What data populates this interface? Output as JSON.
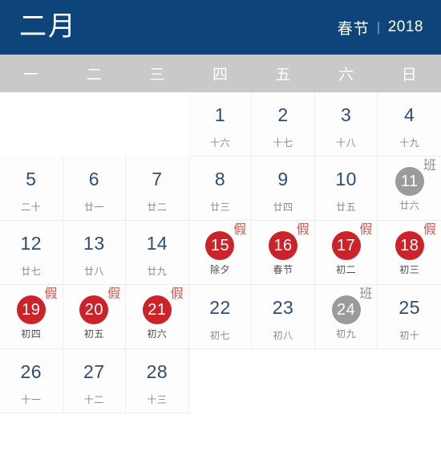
{
  "header": {
    "month_title": "二月",
    "festival_label": "春节",
    "separator": "|",
    "year_label": "2018"
  },
  "weekdays": [
    {
      "label": "一"
    },
    {
      "label": "二"
    },
    {
      "label": "三"
    },
    {
      "label": "四"
    },
    {
      "label": "五"
    },
    {
      "label": "六"
    },
    {
      "label": "日"
    }
  ],
  "colors": {
    "header_bg": "#0d4479",
    "weekday_bg": "#c9c9c9",
    "day_number": "#2d4d74",
    "lunar_text": "#8a8a8a",
    "holiday_red": "#cc2229",
    "workday_gray": "#9b9b9b",
    "cell_border": "#ececec"
  },
  "badge_labels": {
    "holiday": "假",
    "workday": "班"
  },
  "days": [
    {
      "num": "",
      "lunar": "",
      "type": "empty"
    },
    {
      "num": "",
      "lunar": "",
      "type": "empty"
    },
    {
      "num": "",
      "lunar": "",
      "type": "empty"
    },
    {
      "num": "1",
      "lunar": "十六",
      "type": "normal"
    },
    {
      "num": "2",
      "lunar": "十七",
      "type": "normal"
    },
    {
      "num": "3",
      "lunar": "十八",
      "type": "normal"
    },
    {
      "num": "4",
      "lunar": "十九",
      "type": "normal"
    },
    {
      "num": "5",
      "lunar": "二十",
      "type": "normal"
    },
    {
      "num": "6",
      "lunar": "廿一",
      "type": "normal"
    },
    {
      "num": "7",
      "lunar": "廿二",
      "type": "normal"
    },
    {
      "num": "8",
      "lunar": "廿三",
      "type": "normal"
    },
    {
      "num": "9",
      "lunar": "廿四",
      "type": "normal"
    },
    {
      "num": "10",
      "lunar": "廿五",
      "type": "normal"
    },
    {
      "num": "11",
      "lunar": "廿六",
      "type": "workday",
      "badge": "班"
    },
    {
      "num": "12",
      "lunar": "廿七",
      "type": "normal"
    },
    {
      "num": "13",
      "lunar": "廿八",
      "type": "normal"
    },
    {
      "num": "14",
      "lunar": "廿九",
      "type": "normal"
    },
    {
      "num": "15",
      "lunar": "除夕",
      "type": "holiday",
      "badge": "假"
    },
    {
      "num": "16",
      "lunar": "春节",
      "type": "holiday",
      "badge": "假"
    },
    {
      "num": "17",
      "lunar": "初二",
      "type": "holiday",
      "badge": "假"
    },
    {
      "num": "18",
      "lunar": "初三",
      "type": "holiday",
      "badge": "假"
    },
    {
      "num": "19",
      "lunar": "初四",
      "type": "holiday",
      "badge": "假"
    },
    {
      "num": "20",
      "lunar": "初五",
      "type": "holiday",
      "badge": "假"
    },
    {
      "num": "21",
      "lunar": "初六",
      "type": "holiday",
      "badge": "假"
    },
    {
      "num": "22",
      "lunar": "初七",
      "type": "normal"
    },
    {
      "num": "23",
      "lunar": "初八",
      "type": "normal"
    },
    {
      "num": "24",
      "lunar": "初九",
      "type": "workday",
      "badge": "班"
    },
    {
      "num": "25",
      "lunar": "初十",
      "type": "normal"
    },
    {
      "num": "26",
      "lunar": "十一",
      "type": "normal"
    },
    {
      "num": "27",
      "lunar": "十二",
      "type": "normal"
    },
    {
      "num": "28",
      "lunar": "十三",
      "type": "normal"
    },
    {
      "num": "",
      "lunar": "",
      "type": "empty"
    },
    {
      "num": "",
      "lunar": "",
      "type": "empty"
    },
    {
      "num": "",
      "lunar": "",
      "type": "empty"
    },
    {
      "num": "",
      "lunar": "",
      "type": "empty"
    }
  ]
}
